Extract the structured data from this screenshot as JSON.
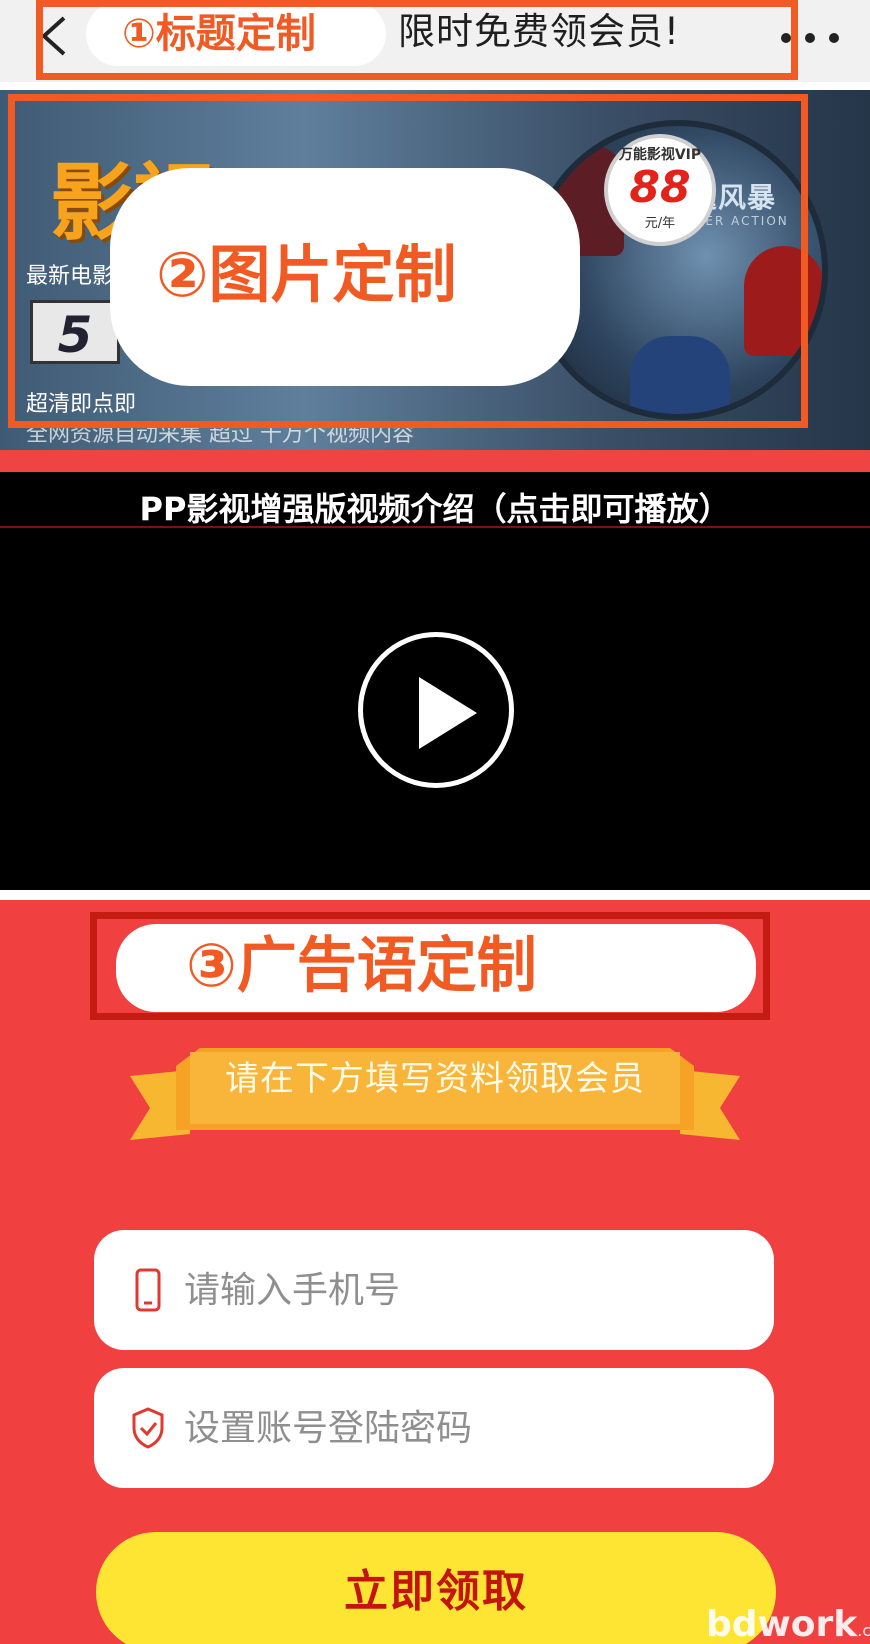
{
  "topbar": {
    "title": "限时免费领会员!",
    "back_icon": "chevron-left-icon",
    "more_icon": "ellipsis-icon"
  },
  "annotations": {
    "title_tag": "①标题定制",
    "image_tag": "②图片定制",
    "slogan_tag": "③广告语定制",
    "box_color": "#f15a22"
  },
  "banner": {
    "logo": "影视VIP",
    "line1": "最新电影",
    "line2": "超清即点即",
    "line3": "全网资源自动采集 超过 千万个视频内容",
    "badge_digit": "5",
    "disc_title": "雷霆风暴",
    "disc_subtitle": "THUNDER ACTION",
    "price_label": "万能影视VIP",
    "price_value": "88",
    "price_unit": "元/年"
  },
  "video": {
    "title": "PP影视增强版视频介绍（点击即可播放）",
    "play_icon": "play-icon"
  },
  "form": {
    "ribbon_text": "请在下方填写资料领取会员",
    "phone_placeholder": "请输入手机号",
    "phone_icon": "phone-icon",
    "password_placeholder": "设置账号登陆密码",
    "password_icon": "shield-check-icon",
    "submit_label": "立即领取",
    "accent_color": "#f04040",
    "button_color": "#ffe533"
  },
  "watermark": {
    "text": "bdwork",
    "suffix": ".com"
  }
}
